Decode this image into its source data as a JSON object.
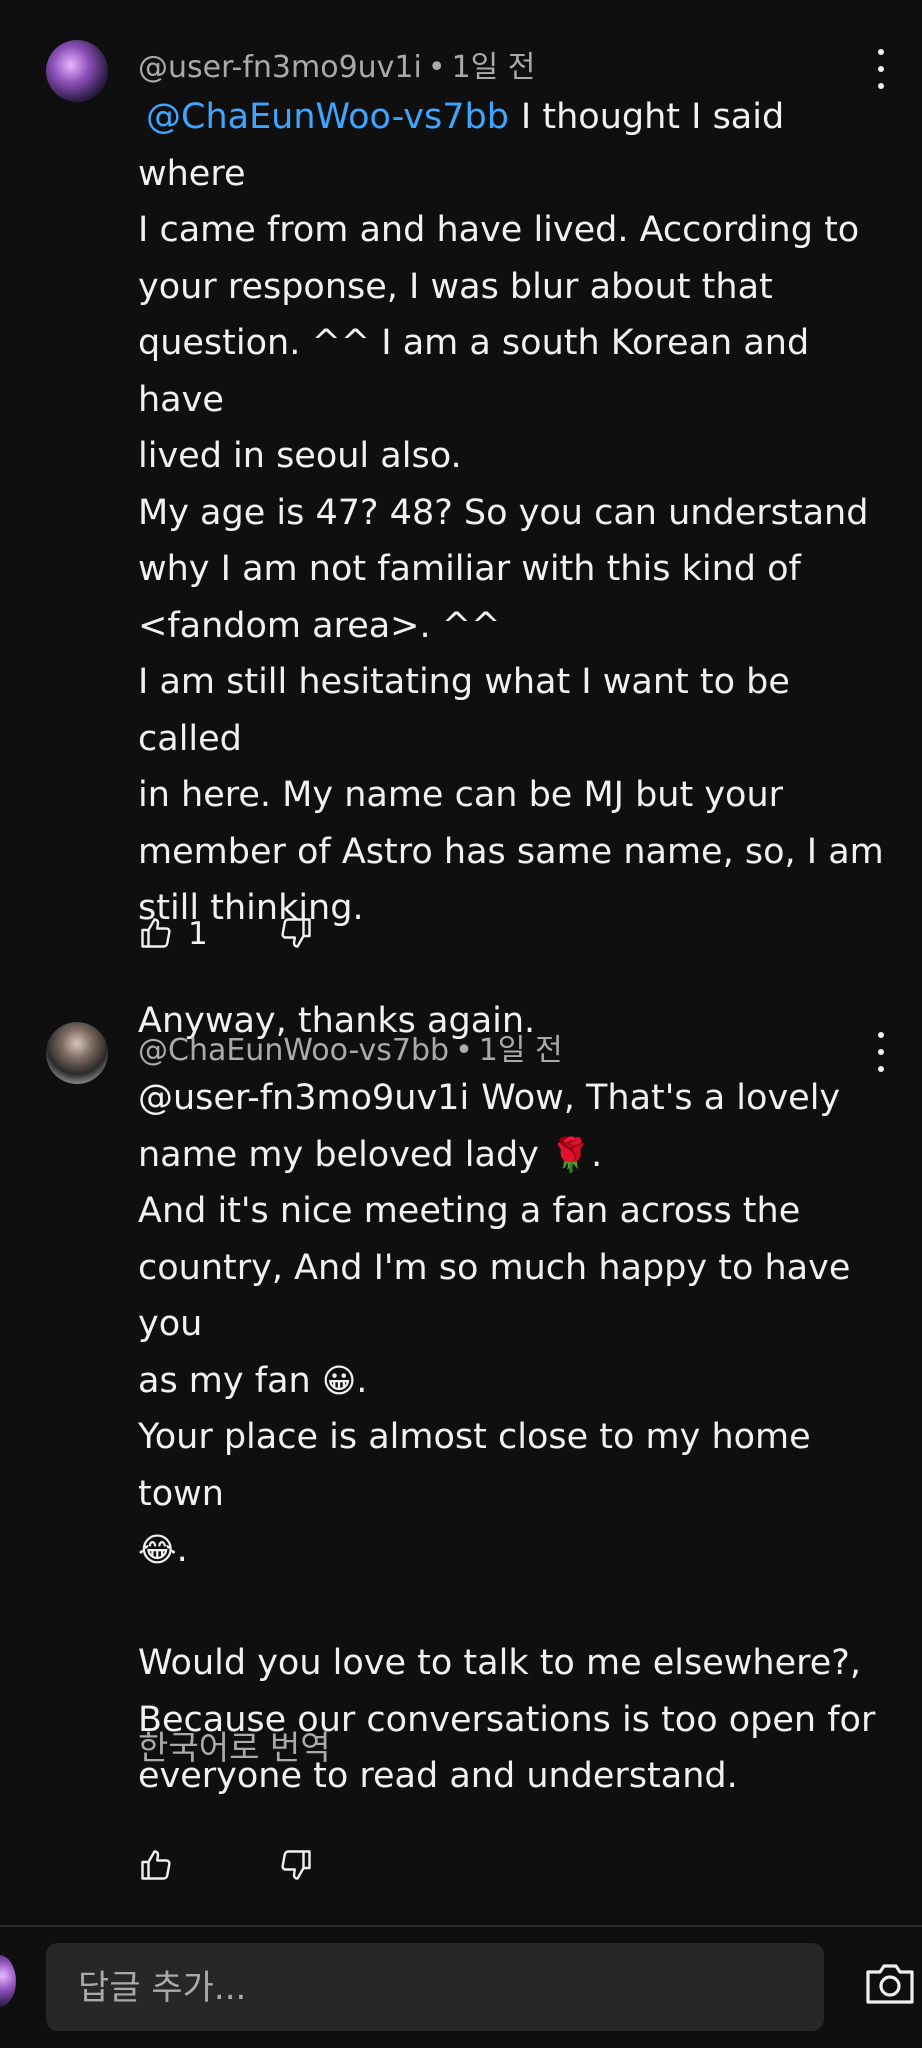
{
  "comments": [
    {
      "author": "@user-fn3mo9uv1i",
      "time": "1일 전",
      "mention": "@ChaEunWoo-vs7bb",
      "first_line_rest": "I thought I said where",
      "lines": [
        "I came from and have lived. According to",
        "your response, I was blur about that",
        "question. ^^ I am a south Korean and have",
        "lived in seoul also.",
        "My age is 47? 48? So you can understand",
        "why I am not familiar with this kind of",
        "<fandom area>. ^^",
        "I am still hesitating what I want to be called",
        "in here. My name can be MJ but your",
        "member of Astro has same name, so, I am",
        "still thinking."
      ],
      "closing": "Anyway, thanks again.",
      "like_count": "1",
      "avatar_icon": "avatar-galaxy",
      "mention_color": "#3ea6ff"
    },
    {
      "author": "@ChaEunWoo-vs7bb",
      "time": "1일 전",
      "mention": "@user-fn3mo9uv1i",
      "first_line_rest": "Wow, That's a lovely",
      "line2_text": "name my beloved lady",
      "line2_emoji": "🌹",
      "line2_end": ".",
      "line3": "And it's nice meeting a fan across the",
      "line4": "country, And I'm so much happy to have you",
      "line5_text": "as my fan",
      "line5_emoji": "😀",
      "line5_end": ".",
      "line6": "Your place is almost close to my home town",
      "line7_emoji": "😂",
      "line7_end": ".",
      "line8": "Would you love to talk to me elsewhere?,",
      "line9": "Because our conversations is too open for",
      "line10": "everyone to read and understand.",
      "translate_label": "한국어로 번역",
      "avatar_icon": "avatar-portrait"
    }
  ],
  "reply": {
    "placeholder": "답글 추가..."
  }
}
